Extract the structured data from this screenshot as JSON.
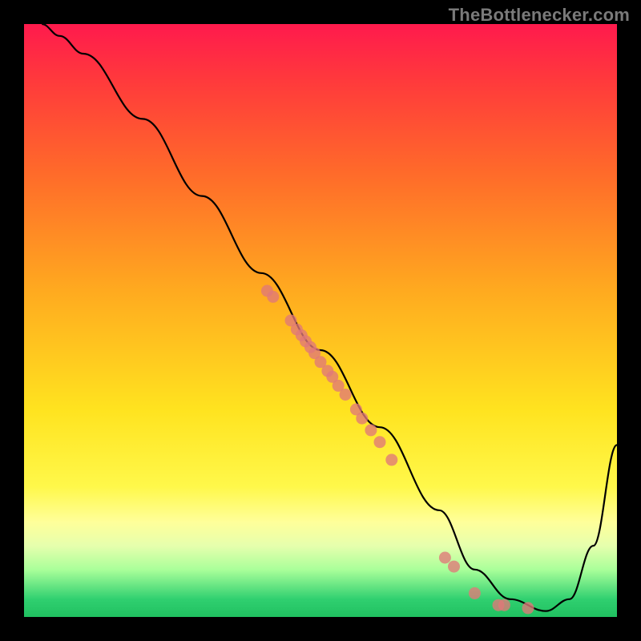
{
  "attribution": "TheBottlenecker.com",
  "chart_data": {
    "type": "line",
    "title": "",
    "xlabel": "",
    "ylabel": "",
    "xlim": [
      0,
      100
    ],
    "ylim": [
      0,
      100
    ],
    "series": [
      {
        "name": "curve",
        "x": [
          3,
          6,
          10,
          20,
          30,
          40,
          50,
          60,
          70,
          76,
          82,
          88,
          92,
          96,
          100
        ],
        "y": [
          100,
          98,
          95,
          84,
          71,
          58,
          45,
          32,
          18,
          8,
          3,
          1,
          3,
          12,
          29
        ]
      },
      {
        "name": "points",
        "x": [
          41,
          42,
          45,
          46,
          46.8,
          47.5,
          48.3,
          49,
          50,
          51.2,
          52,
          53,
          54.2,
          56,
          57,
          58.5,
          60,
          62,
          71,
          72.5,
          76,
          80,
          81,
          85
        ],
        "y": [
          55,
          54,
          50,
          48.5,
          47.5,
          46.5,
          45.5,
          44.5,
          43,
          41.5,
          40.5,
          39,
          37.5,
          35,
          33.5,
          31.5,
          29.5,
          26.5,
          10,
          8.5,
          4,
          2,
          2,
          1.5
        ]
      }
    ]
  }
}
